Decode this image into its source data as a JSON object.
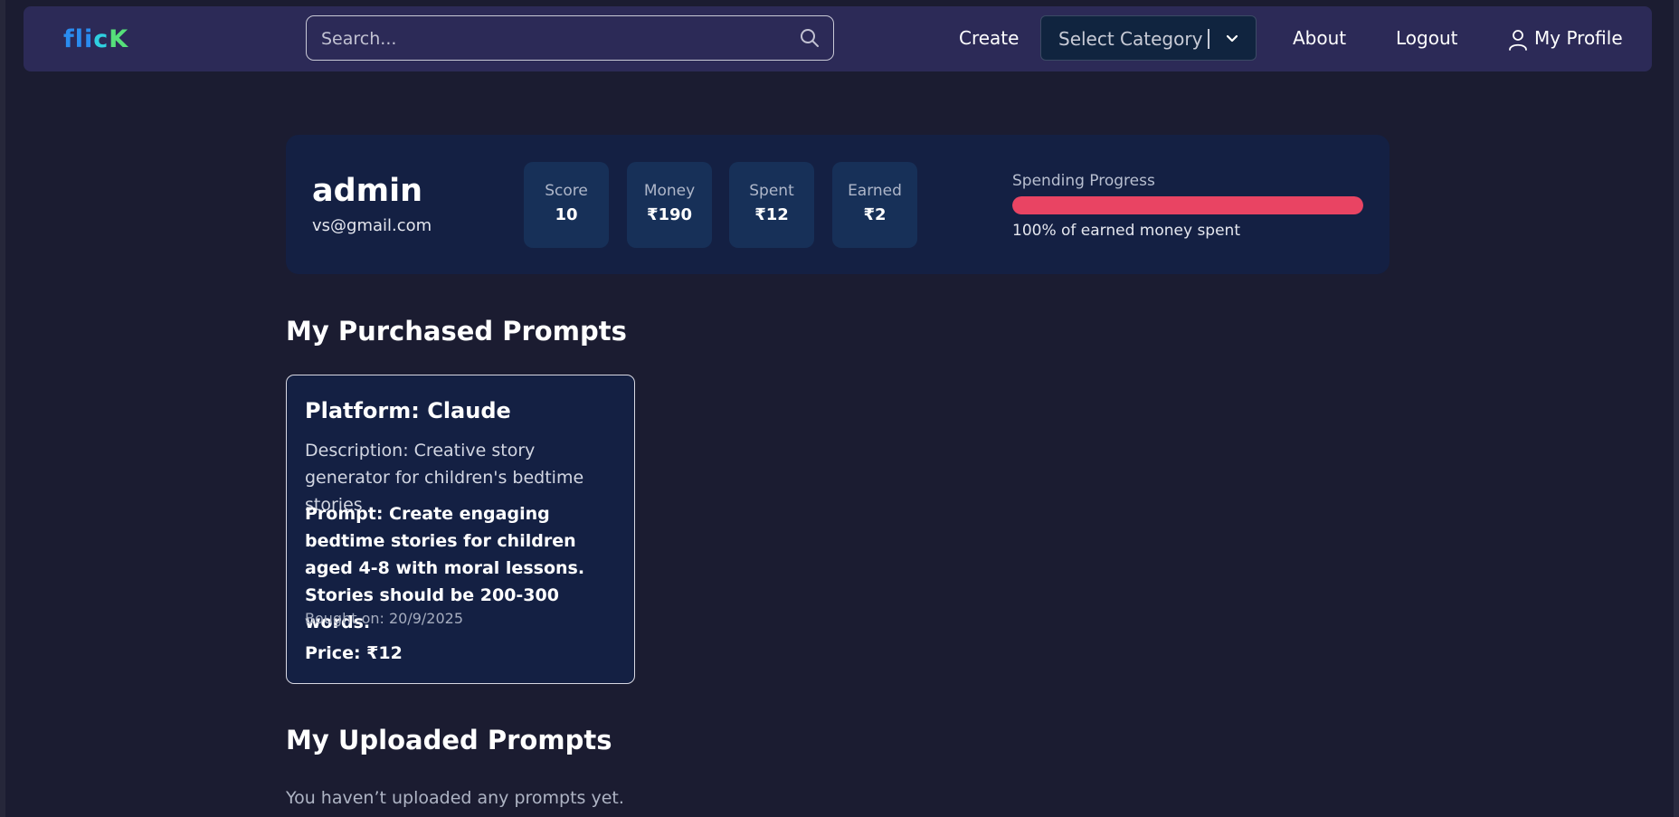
{
  "nav": {
    "logo": {
      "part1": "fli",
      "part2": "c",
      "part3": "K"
    },
    "search_placeholder": "Search...",
    "create_label": "Create",
    "category_label": "Select Category",
    "about_label": "About",
    "logout_label": "Logout",
    "profile_label": "My Profile"
  },
  "profile": {
    "username": "admin",
    "email": "vs@gmail.com",
    "stats": [
      {
        "label": "Score",
        "value": "10"
      },
      {
        "label": "Money",
        "value": "₹190"
      },
      {
        "label": "Spent",
        "value": "₹12"
      },
      {
        "label": "Earned",
        "value": "₹2"
      }
    ],
    "spending_label": "Spending Progress",
    "spending_percent": 100,
    "spending_text": "100% of earned money spent"
  },
  "purchased": {
    "title": "My Purchased Prompts",
    "items": [
      {
        "platform": "Platform: Claude",
        "description": "Description: Creative story generator for children's bedtime stories",
        "prompt": "Prompt: Create engaging bedtime stories for children aged 4-8 with moral lessons. Stories should be 200-300 words.",
        "bought_on": "Bought on: 20/9/2025",
        "price": "Price: ₹12"
      }
    ]
  },
  "uploaded": {
    "title": "My Uploaded Prompts",
    "empty_message": "You haven’t uploaded any prompts yet."
  },
  "colors": {
    "background": "#1b1c31",
    "navbar": "#2c2a57",
    "card": "#142043",
    "stat_box": "#173058",
    "progress_fill": "#e94463",
    "logo_blue": "#2a8cf0",
    "logo_green": "#56e07a"
  }
}
